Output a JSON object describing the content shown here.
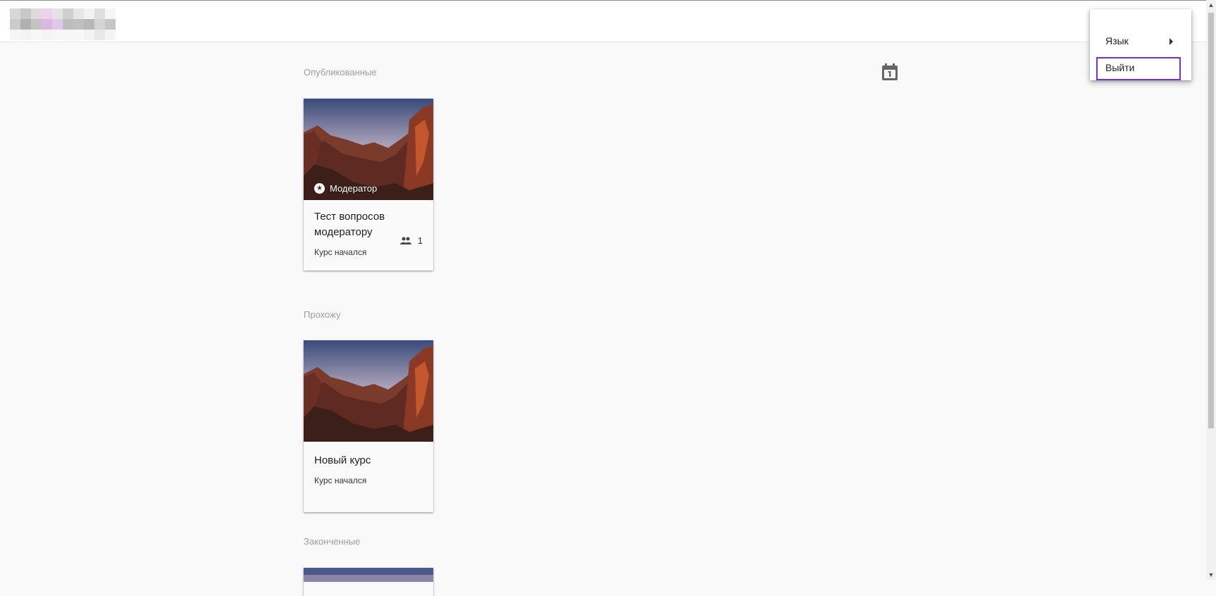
{
  "header": {
    "logo_icon": "blurred-logo"
  },
  "sections": [
    {
      "title": "Опубликованные",
      "cards": [
        {
          "title": "Тест вопросов модератору",
          "status": "Курс начался",
          "role": "Модератор",
          "participants": "1"
        }
      ]
    },
    {
      "title": "Прохожу",
      "cards": [
        {
          "title": "Новый курс",
          "status": "Курс начался"
        }
      ]
    },
    {
      "title": "Законченные",
      "cards": []
    }
  ],
  "calendar_icon": "calendar-icon",
  "menu": {
    "items": [
      {
        "label": "Язык",
        "icon": "submenu-arrow-icon"
      },
      {
        "label": "Выйти"
      }
    ]
  },
  "colors": {
    "menu_focus_border": "#7b2fd1",
    "background": "#f9f9f9"
  }
}
